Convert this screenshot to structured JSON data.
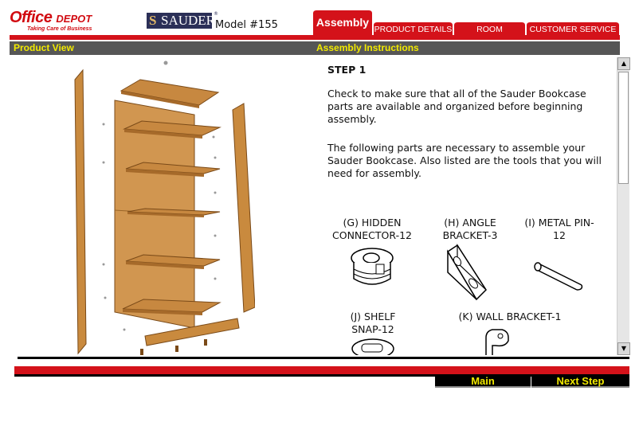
{
  "header": {
    "logo": {
      "word1": "Office",
      "word2": "DEPOT",
      "tagline": "Taking Care of Business"
    },
    "brand": {
      "name": "SAUDER",
      "mark": "S",
      "registered": "®"
    },
    "model": "Model #155"
  },
  "tabs": {
    "assembly": "Assembly",
    "product_details": "PRODUCT DETAILS",
    "room_designer": "ROOM DESIGNER",
    "customer_service": "CUSTOMER SERVICE"
  },
  "section": {
    "left": "Product View",
    "right": "Assembly Instructions"
  },
  "instructions": {
    "step": "STEP 1",
    "p1": "Check to make sure that all of the Sauder Bookcase parts are available and organized before beginning assembly.",
    "p2": "The following parts are necessary to assemble your Sauder Bookcase. Also listed are the tools that you will need for assembly.",
    "parts": {
      "g": "(G) HIDDEN CONNECTOR-12",
      "h": "(H) ANGLE BRACKET-3",
      "i": "(I) METAL PIN-12",
      "j": "(J) SHELF SNAP-12",
      "k": "(K) WALL BRACKET-1"
    }
  },
  "footer": {
    "main": "Main",
    "next": "Next Step"
  },
  "colors": {
    "accent_red": "#d4121a",
    "bar_gray": "#565656",
    "bar_text": "#f2ea00",
    "wood": "#c98a3e"
  },
  "icons": {
    "up": "▲",
    "down": "▼"
  }
}
